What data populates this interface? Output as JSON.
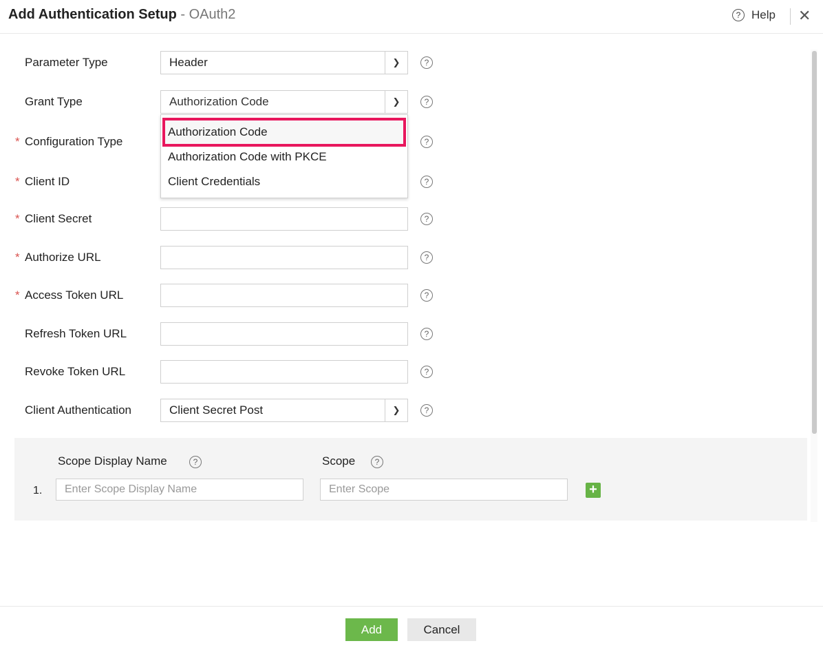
{
  "header": {
    "title": "Add Authentication Setup",
    "separator": " - ",
    "subtitle": "OAuth2",
    "help_label": "Help",
    "help_icon": "help-circle-icon",
    "close_icon": "close-icon"
  },
  "form": {
    "parameter_type": {
      "label": "Parameter Type",
      "value": "Header"
    },
    "grant_type": {
      "label": "Grant Type",
      "value": "Authorization Code",
      "options": [
        "Authorization Code",
        "Authorization Code with PKCE",
        "Client Credentials"
      ],
      "highlighted_option": "Authorization Code"
    },
    "configuration_type": {
      "label": "Configuration Type",
      "required": true
    },
    "client_id": {
      "label": "Client ID",
      "required": true
    },
    "client_secret": {
      "label": "Client Secret",
      "required": true,
      "value": ""
    },
    "authorize_url": {
      "label": "Authorize URL",
      "required": true,
      "value": ""
    },
    "access_token_url": {
      "label": "Access Token URL",
      "required": true,
      "value": ""
    },
    "refresh_token_url": {
      "label": "Refresh Token URL",
      "value": ""
    },
    "revoke_token_url": {
      "label": "Revoke Token URL",
      "value": ""
    },
    "client_authentication": {
      "label": "Client Authentication",
      "value": "Client Secret Post"
    },
    "required_marker": "*"
  },
  "scope": {
    "display_name_header": "Scope Display Name",
    "scope_header": "Scope",
    "rows": [
      {
        "index": "1.",
        "display_name_placeholder": "Enter Scope Display Name",
        "scope_placeholder": "Enter Scope"
      }
    ]
  },
  "footer": {
    "add_label": "Add",
    "cancel_label": "Cancel"
  },
  "colors": {
    "accent_green": "#6cb84b",
    "highlight_pink": "#e8175d",
    "required_red": "#d9534f"
  }
}
